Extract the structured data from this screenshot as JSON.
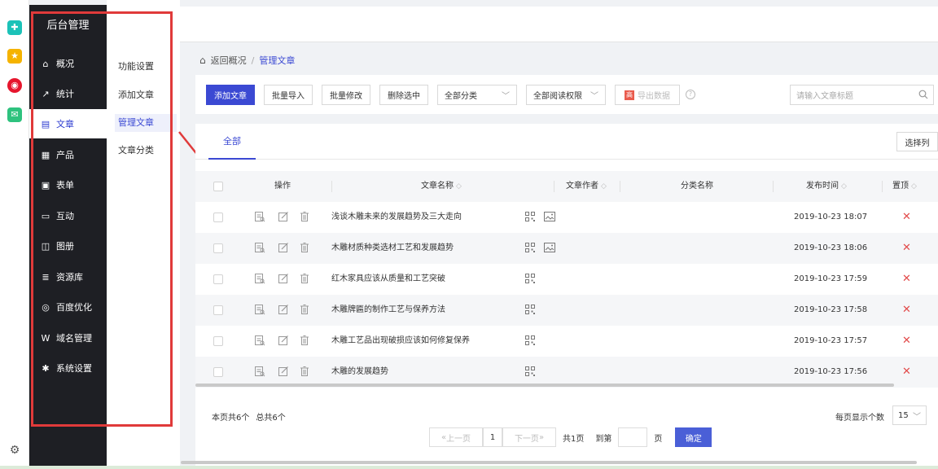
{
  "sidebar": {
    "title": "后台管理",
    "items": [
      {
        "label": "概况",
        "icon": "home-icon",
        "glyph": "⌂"
      },
      {
        "label": "统计",
        "icon": "chart-icon",
        "glyph": "↗"
      },
      {
        "label": "文章",
        "icon": "article-icon",
        "glyph": "▤"
      },
      {
        "label": "产品",
        "icon": "grid-icon",
        "glyph": "▦"
      },
      {
        "label": "表单",
        "icon": "form-icon",
        "glyph": "▣"
      },
      {
        "label": "互动",
        "icon": "chat-icon",
        "glyph": "▭"
      },
      {
        "label": "图册",
        "icon": "album-icon",
        "glyph": "◫"
      },
      {
        "label": "资源库",
        "icon": "database-icon",
        "glyph": "≣"
      },
      {
        "label": "百度优化",
        "icon": "baidu-icon",
        "glyph": "◎"
      },
      {
        "label": "域名管理",
        "icon": "domain-icon",
        "glyph": "W"
      },
      {
        "label": "系统设置",
        "icon": "gear-icon",
        "glyph": "✱"
      }
    ]
  },
  "submenu": {
    "items": [
      "功能设置",
      "添加文章",
      "管理文章",
      "文章分类"
    ]
  },
  "breadcrumb": {
    "back": "返回概况",
    "sep": "/",
    "current": "管理文章"
  },
  "toolbar": {
    "add": "添加文章",
    "batch_import": "批量导入",
    "batch_edit": "批量修改",
    "delete_selected": "删除选中",
    "category_select": "全部分类",
    "permission_select": "全部阅读权限",
    "export": "导出数据",
    "export_badge": "高",
    "help": "?",
    "search_placeholder": "请输入文章标题"
  },
  "tabs": {
    "all": "全部",
    "choose_columns": "选择列"
  },
  "table": {
    "headers": {
      "action": "操作",
      "title": "文章名称",
      "author": "文章作者",
      "category": "分类名称",
      "date": "发布时间",
      "pin": "置顶"
    },
    "rows": [
      {
        "title": "浅谈木雕未来的发展趋势及三大走向",
        "date": "2019-10-23 18:07",
        "has_image": true
      },
      {
        "title": "木雕材质种类选材工艺和发展趋势",
        "date": "2019-10-23 18:06",
        "has_image": true
      },
      {
        "title": "红木家具应该从质量和工艺突破",
        "date": "2019-10-23 17:59",
        "has_image": false
      },
      {
        "title": "木雕牌匾的制作工艺与保养方法",
        "date": "2019-10-23 17:58",
        "has_image": false
      },
      {
        "title": "木雕工艺品出现破损应该如何修复保养",
        "date": "2019-10-23 17:57",
        "has_image": false
      },
      {
        "title": "木雕的发展趋势",
        "date": "2019-10-23 17:56",
        "has_image": false
      }
    ]
  },
  "footer": {
    "page_info": "本页共6个",
    "total_info": "总共6个",
    "prev": "上一页",
    "page_num": "1",
    "next": "下一页",
    "total_pages": "共1页",
    "goto_label": "到第",
    "page_unit": "页",
    "confirm": "确定",
    "per_page_label": "每页显示个数",
    "per_page_value": "15"
  },
  "colors": {
    "primary": "#3b49d3",
    "sidebar_bg": "#1e1f24",
    "highlight_red": "#e03a3a",
    "pin_x": "#e24a4a"
  }
}
